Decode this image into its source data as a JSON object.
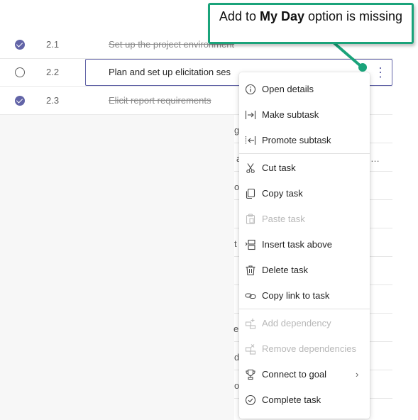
{
  "tasks": [
    {
      "number": "2.1",
      "name": "Set up the project environment",
      "completed": true
    },
    {
      "number": "2.2",
      "name": "Plan and set up elicitation ses",
      "completed": false
    },
    {
      "number": "2.3",
      "name": "Elicit report requirements",
      "completed": true
    }
  ],
  "background_fragments": [
    "g",
    "a",
    "…",
    "o",
    "t",
    "e",
    "d",
    "o"
  ],
  "context_menu": {
    "items": [
      {
        "label": "Open details",
        "icon": "info-icon",
        "enabled": true
      },
      {
        "label": "Make subtask",
        "icon": "indent-icon",
        "enabled": true
      },
      {
        "label": "Promote subtask",
        "icon": "outdent-icon",
        "enabled": true
      },
      {
        "label": "Cut task",
        "icon": "scissors-icon",
        "enabled": true
      },
      {
        "label": "Copy task",
        "icon": "copy-icon",
        "enabled": true
      },
      {
        "label": "Paste task",
        "icon": "paste-icon",
        "enabled": false
      },
      {
        "label": "Insert task above",
        "icon": "insert-above-icon",
        "enabled": true
      },
      {
        "label": "Delete task",
        "icon": "trash-icon",
        "enabled": true
      },
      {
        "label": "Copy link to task",
        "icon": "link-icon",
        "enabled": true
      },
      {
        "label": "Add dependency",
        "icon": "add-dependency-icon",
        "enabled": false
      },
      {
        "label": "Remove dependencies",
        "icon": "remove-dependency-icon",
        "enabled": false
      },
      {
        "label": "Connect to goal",
        "icon": "trophy-icon",
        "enabled": true
      },
      {
        "label": "Complete task",
        "icon": "check-circle-icon",
        "enabled": true
      }
    ]
  },
  "callout": {
    "prefix": "Add to ",
    "bold": "My Day",
    "suffix": " option is missing",
    "border_color": "#1aa37a"
  },
  "accent_color": "#6264a7"
}
